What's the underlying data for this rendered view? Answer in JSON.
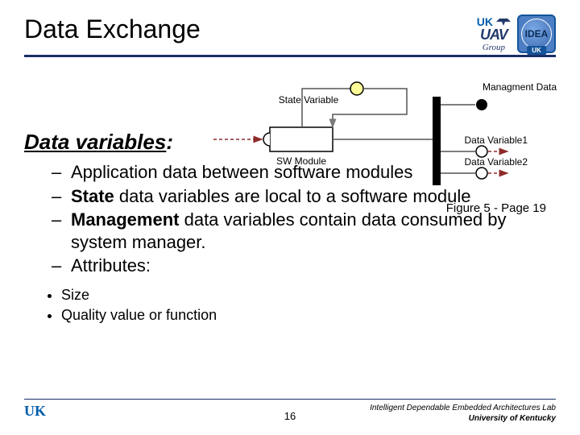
{
  "header": {
    "title": "Data Exchange",
    "logos": {
      "uk": "UK",
      "uav": "UAV",
      "group": "Group",
      "idea": "IDEA",
      "uk_tab": "UK"
    }
  },
  "section": {
    "heading_underlined": "Data variables",
    "heading_colon": ":"
  },
  "bullets": {
    "b1": "Application data  between software modules",
    "b2_prefix_bold": "State",
    "b2_rest": " data variables are local to a software module",
    "b3_prefix_bold": "Management",
    "b3_rest": " data variables contain data consumed by system manager.",
    "b4": "Attributes:",
    "sub1": "Size",
    "sub2": "Quality value or function"
  },
  "diagram": {
    "state_variable": "State Variable",
    "management_data": "Managment Data",
    "sw_module": "SW Module",
    "data_variable1": "Data Variable1",
    "data_variable2": "Data Variable2"
  },
  "figure_caption": "Figure 5 - Page 19",
  "footer": {
    "page": "16",
    "lab": "Intelligent Dependable Embedded Architectures Lab",
    "uni": "University of Kentucky",
    "uk_logo": "UK"
  }
}
